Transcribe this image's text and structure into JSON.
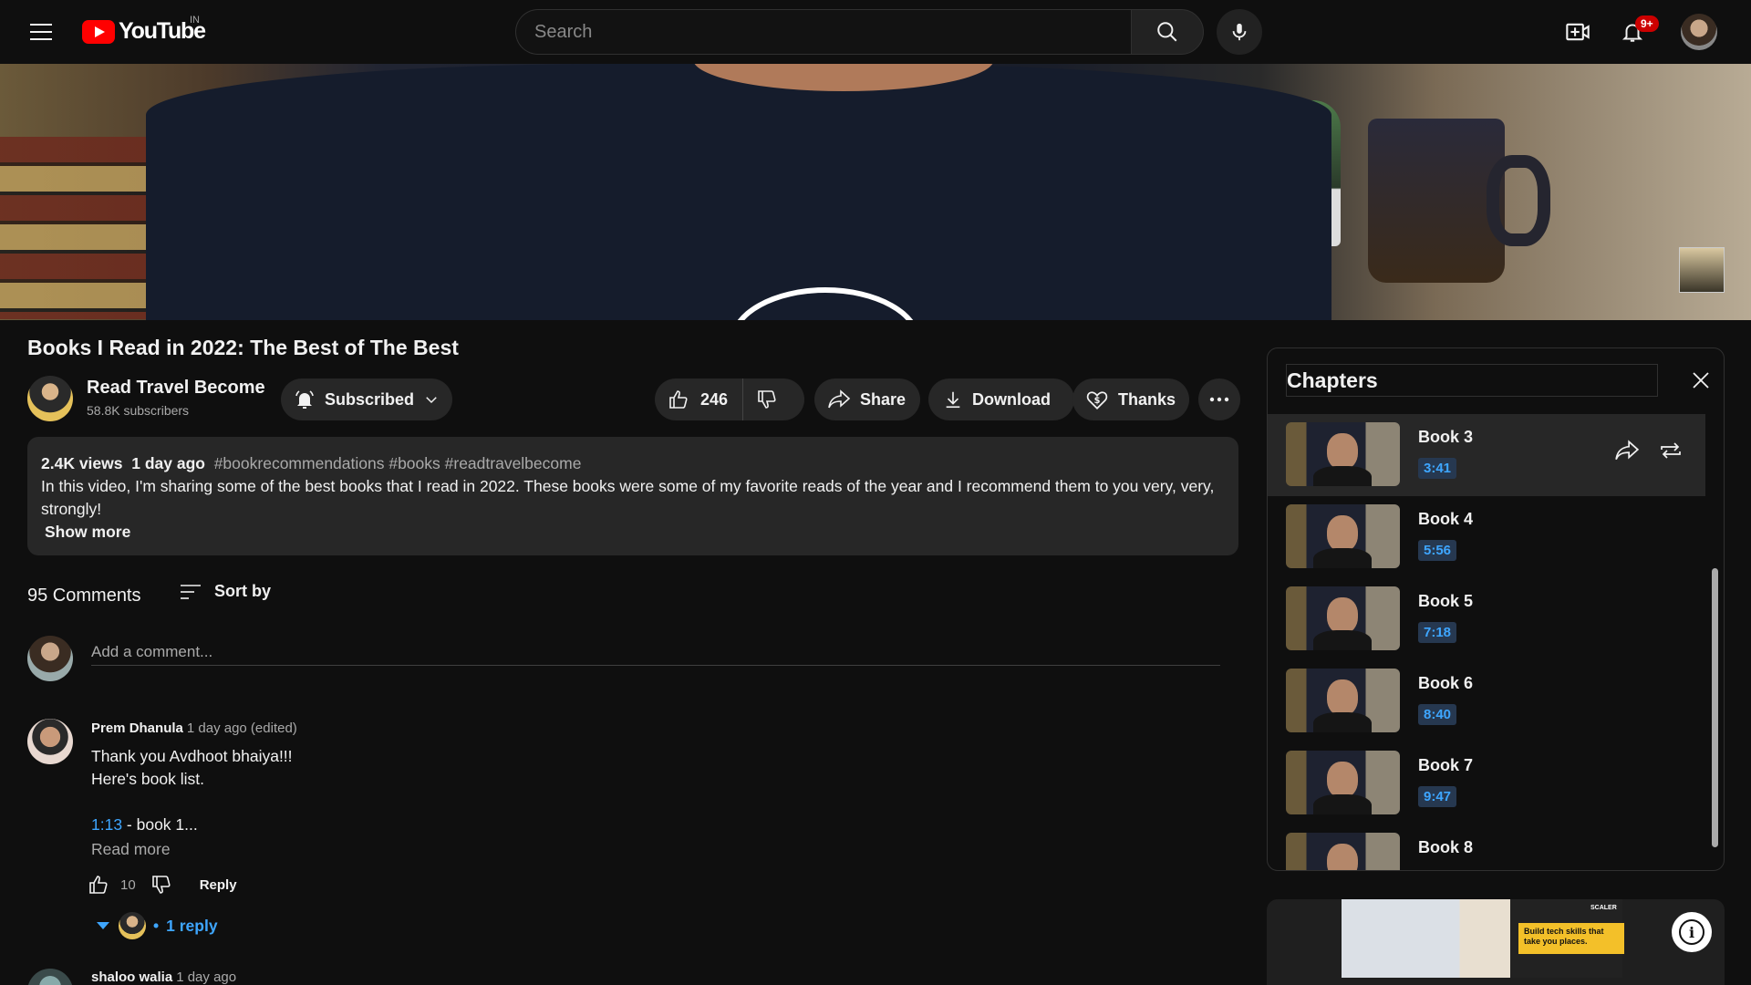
{
  "header": {
    "logo_text": "YouTube",
    "country_code": "IN",
    "search_placeholder": "Search",
    "notification_badge": "9+"
  },
  "video": {
    "title": "Books I Read in 2022: The Best of The Best"
  },
  "owner": {
    "channel_name": "Read Travel Become",
    "subscribers": "58.8K subscribers",
    "subscribe_label": "Subscribed"
  },
  "actions": {
    "like_count": "246",
    "share_label": "Share",
    "download_label": "Download",
    "thanks_label": "Thanks"
  },
  "description": {
    "views": "2.4K views",
    "date": "1 day ago",
    "tags": "#bookrecommendations #books #readtravelbecome",
    "text": "In this video, I'm sharing some of the best books that I read in 2022. These books were some of my favorite reads of the year and I recommend them to you very, very, strongly!",
    "show_more": "Show more"
  },
  "comments": {
    "count_label": "95 Comments",
    "sort_label": "Sort by",
    "add_placeholder": "Add a comment...",
    "items": [
      {
        "author": "Prem Dhanula",
        "time": "1 day ago (edited)",
        "line1": "Thank you Avdhoot bhaiya!!!",
        "line2": "Here's book list.",
        "timestamp_link": "1:13",
        "timestamp_text": " - book 1...",
        "read_more": "Read more",
        "likes": "10",
        "reply_label": "Reply",
        "replies_label": "1 reply"
      },
      {
        "author": "shaloo walia",
        "time": "1 day ago"
      }
    ]
  },
  "chapters": {
    "title": "Chapters",
    "items": [
      {
        "name": "Book 3",
        "time": "3:41",
        "active": true
      },
      {
        "name": "Book 4",
        "time": "5:56"
      },
      {
        "name": "Book 5",
        "time": "7:18"
      },
      {
        "name": "Book 6",
        "time": "8:40"
      },
      {
        "name": "Book 7",
        "time": "9:47"
      },
      {
        "name": "Book 8",
        "time": ""
      }
    ]
  },
  "ad": {
    "brand": "SCALER",
    "banner_text": "Build tech skills that take you places."
  },
  "colors": {
    "background": "#0f0f0f",
    "surface": "#272727",
    "link": "#3ea6ff",
    "brand_red": "#ff0000",
    "badge_red": "#cc0000"
  },
  "icons": [
    "menu-icon",
    "youtube-logo-icon",
    "search-icon",
    "mic-icon",
    "create-icon",
    "bell-icon",
    "like-icon",
    "dislike-icon",
    "share-icon",
    "download-icon",
    "thanks-icon",
    "more-icon",
    "sort-icon",
    "chevron-down-icon",
    "close-icon",
    "loop-icon",
    "info-icon"
  ]
}
